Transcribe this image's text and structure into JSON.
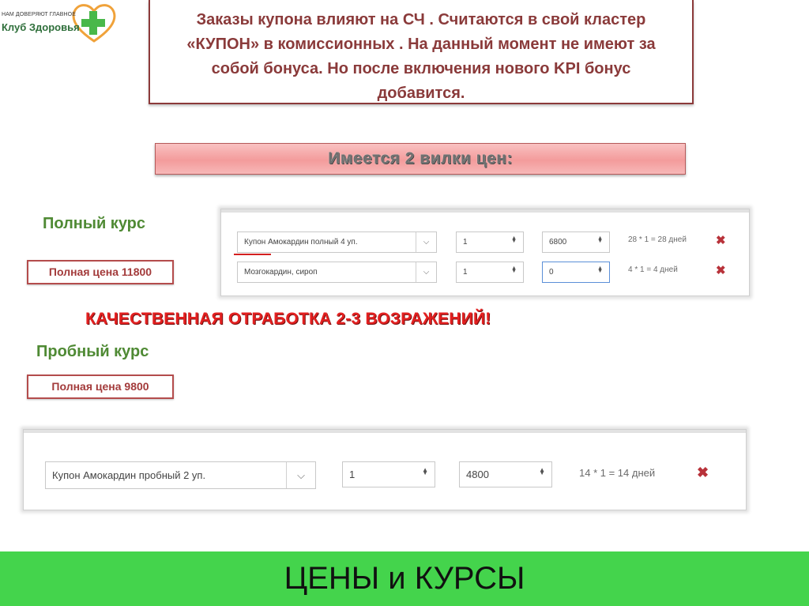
{
  "logo": {
    "tagline": "НАМ ДОВЕРЯЮТ ГЛАВНОЕ",
    "name": "Клуб Здоровья"
  },
  "note": {
    "text": "Заказы купона влияют на СЧ . Считаются в свой кластер «КУПОН»  в комиссионных . На данный момент не имеют за собой бонуса. Но после включения нового KPI бонус добавится."
  },
  "banner": {
    "text": "Имеется  2 вилки  цен:"
  },
  "full_course": {
    "label": "Полный курс",
    "price": "Полная цена 11800",
    "rows": [
      {
        "product": "Купон Амокардин полный 4 уп.",
        "qty": "1",
        "price": "6800",
        "calc": "28 * 1 = 28 дней"
      },
      {
        "product": "Мозгокардин, сироп",
        "qty": "1",
        "price": "0",
        "calc": "4 * 1 = 4 дней"
      }
    ]
  },
  "warning": {
    "text": "КАЧЕСТВЕННАЯ ОТРАБОТКА  2-3 ВОЗРАЖЕНИЙ!"
  },
  "trial_course": {
    "label": "Пробный курс",
    "price": "Полная цена 9800",
    "rows": [
      {
        "product": "Купон Амокардин пробный 2 уп.",
        "qty": "1",
        "price": "4800",
        "calc": "14 * 1 = 14 дней"
      }
    ]
  },
  "footer": {
    "title": "ЦЕНЫ и КУРСЫ"
  },
  "colors": {
    "accent_green": "#44d44c",
    "note_border": "#8c3a3a",
    "delete_icon": "#b8323a",
    "warning_red": "#e32020"
  },
  "icons": [
    "heart-cross-logo-icon",
    "chevron-down-icon",
    "spinner-arrows-icon",
    "delete-x-icon"
  ]
}
